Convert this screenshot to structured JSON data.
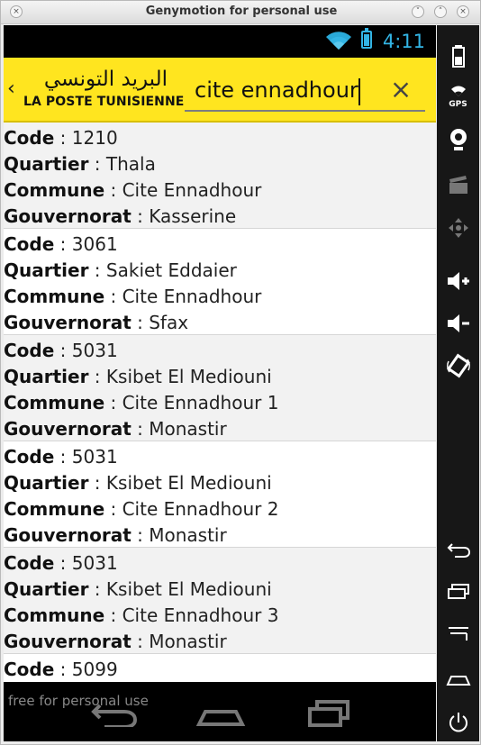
{
  "window": {
    "title": "Genymotion for personal use",
    "watermark": "free for personal use"
  },
  "statusbar": {
    "time": "4:11",
    "icons": [
      "wifi-icon",
      "battery-icon"
    ],
    "color": "#33b5e5"
  },
  "app": {
    "logo_arabic": "البريد التونسي",
    "logo_french": "LA POSTE TUNISIENNE",
    "back_icon": "chevron-left-icon",
    "search": {
      "value": "cite ennadhour",
      "clear_icon": "close-icon"
    },
    "accent_color": "#ffe51f"
  },
  "results": [
    {
      "code_label": "Code",
      "code": "1210",
      "quartier_label": "Quartier",
      "quartier": "Thala",
      "commune_label": "Commune",
      "commune": "Cite Ennadhour",
      "gouvernorat_label": "Gouvernorat",
      "gouvernorat": "Kasserine"
    },
    {
      "code_label": "Code",
      "code": "3061",
      "quartier_label": "Quartier",
      "quartier": "Sakiet Eddaier",
      "commune_label": "Commune",
      "commune": "Cite Ennadhour",
      "gouvernorat_label": "Gouvernorat",
      "gouvernorat": "Sfax"
    },
    {
      "code_label": "Code",
      "code": "5031",
      "quartier_label": "Quartier",
      "quartier": "Ksibet El Mediouni",
      "commune_label": "Commune",
      "commune": "Cite Ennadhour 1",
      "gouvernorat_label": "Gouvernorat",
      "gouvernorat": "Monastir"
    },
    {
      "code_label": "Code",
      "code": "5031",
      "quartier_label": "Quartier",
      "quartier": "Ksibet El Mediouni",
      "commune_label": "Commune",
      "commune": "Cite Ennadhour 2",
      "gouvernorat_label": "Gouvernorat",
      "gouvernorat": "Monastir"
    },
    {
      "code_label": "Code",
      "code": "5031",
      "quartier_label": "Quartier",
      "quartier": "Ksibet El Mediouni",
      "commune_label": "Commune",
      "commune": "Cite Ennadhour 3",
      "gouvernorat_label": "Gouvernorat",
      "gouvernorat": "Monastir"
    },
    {
      "code_label": "Code",
      "code": "5099"
    }
  ],
  "navbar": {
    "icons": [
      "back-icon",
      "home-icon",
      "recent-apps-icon"
    ]
  },
  "sidebar": {
    "icons": [
      "battery-icon",
      "gps-icon",
      "camera-icon",
      "video-icon",
      "dpad-icon",
      "volume-up-icon",
      "volume-down-icon",
      "rotate-icon",
      "back-icon",
      "recent-apps-icon",
      "menu-icon",
      "home-icon",
      "power-icon"
    ],
    "gps_label": "GPS"
  }
}
